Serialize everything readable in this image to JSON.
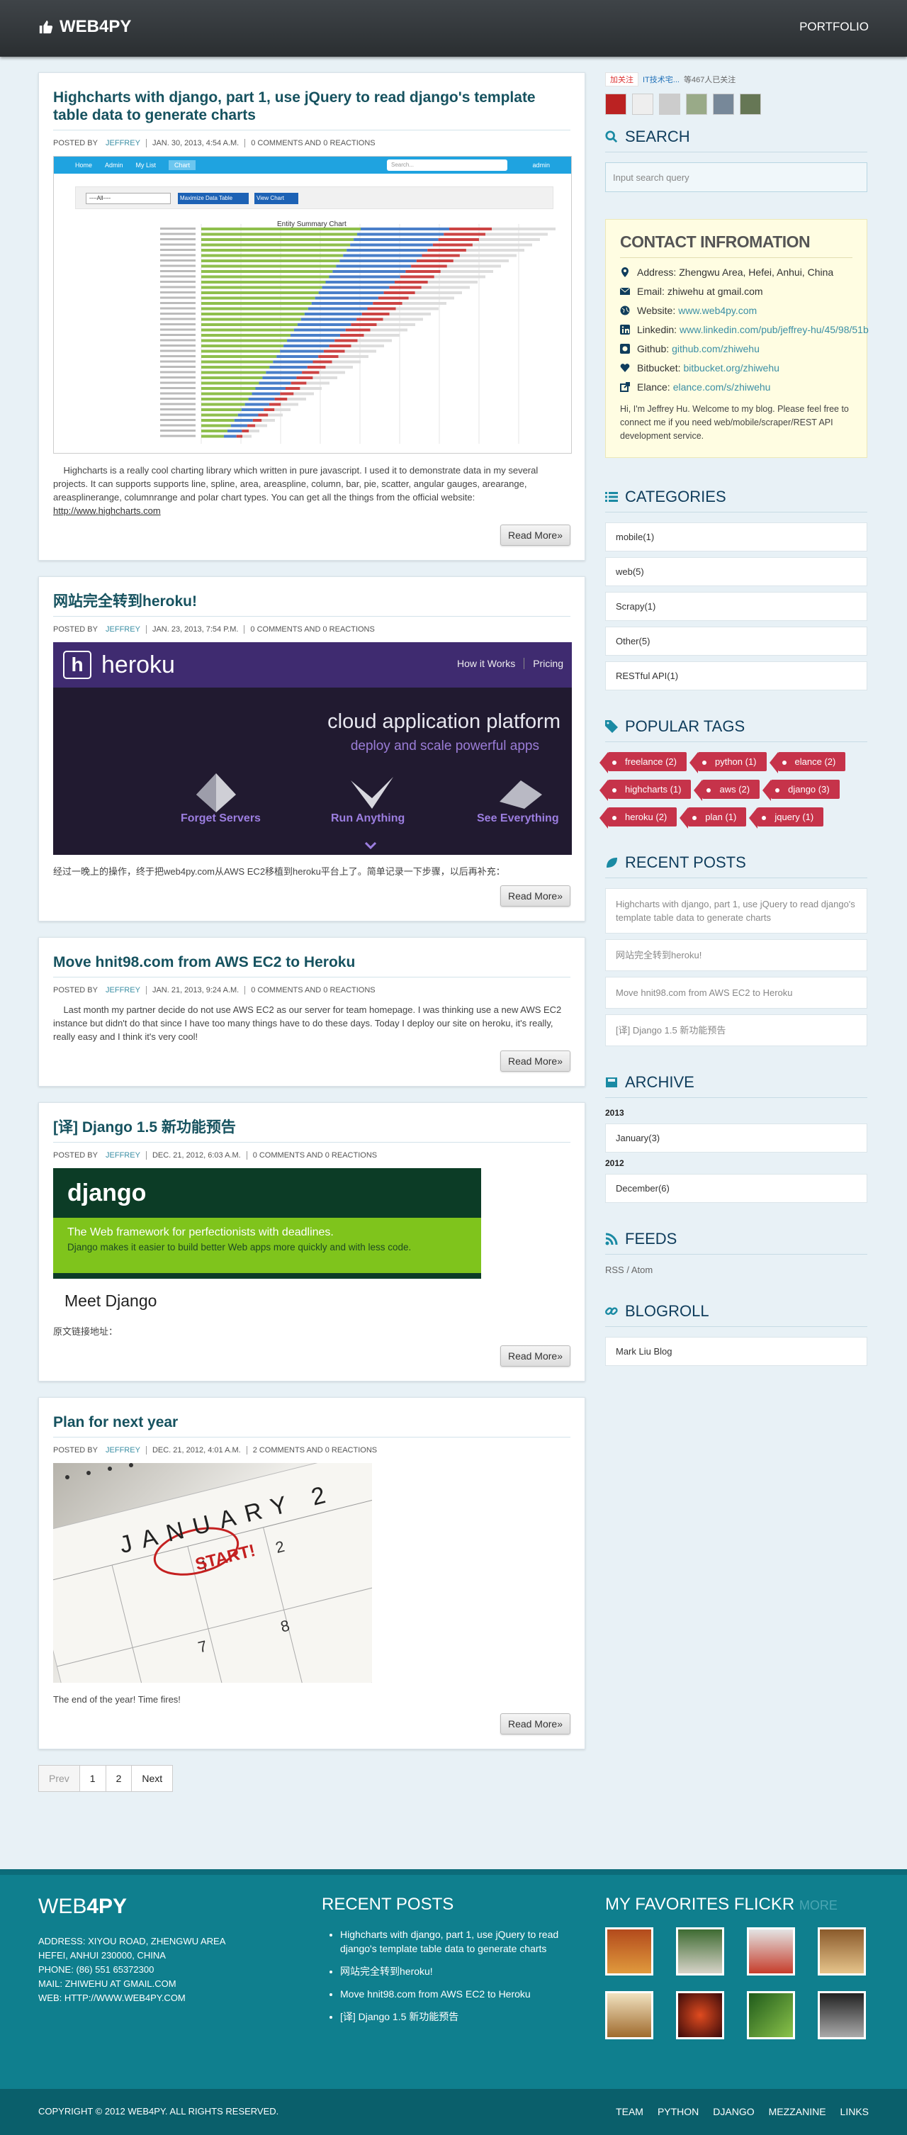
{
  "nav": {
    "brand": "WEB4PY",
    "portfolio": "PORTFOLIO"
  },
  "posts": [
    {
      "title": "Highcharts with django, part 1, use jQuery to read django's template table data to generate charts",
      "author": "JEFFREY",
      "date": "JAN. 30, 2013, 4:54 A.M.",
      "comments": "0 COMMENTS AND 0 REACTIONS",
      "body": "Highcharts is a really cool charting library which written in pure javascript. I used it to demonstrate data in my several projects. It can supports supports line, spline, area, areaspline, column, bar, pie, scatter, angular gauges, arearange, areasplinerange, columnrange and polar chart types.  You can get all the things from the official website: ",
      "link": "http://www.highcharts.com",
      "readmore": "Read More»"
    },
    {
      "title": "网站完全转到heroku!",
      "author": "JEFFREY",
      "date": "JAN. 23, 2013, 7:54 P.M.",
      "comments": "0 COMMENTS AND 0 REACTIONS",
      "body": "经过一晚上的操作，终于把web4py.com从AWS EC2移植到heroku平台上了。简单记录一下步骤，以后再补充：",
      "readmore": "Read More»"
    },
    {
      "title": "Move hnit98.com from AWS EC2 to Heroku",
      "author": "JEFFREY",
      "date": "JAN. 21, 2013, 9:24 A.M.",
      "comments": "0 COMMENTS AND 0 REACTIONS",
      "body": "Last month my partner decide do not use AWS EC2 as our server for team homepage. I was thinking use a new AWS EC2 instance  but didn't do that since I have too many things have to do these days. Today I deploy our site on heroku, it's really, really easy and I think it's very cool!",
      "readmore": "Read More»"
    },
    {
      "title": "[译] Django 1.5 新功能预告",
      "author": "JEFFREY",
      "date": "DEC. 21, 2012, 6:03 A.M.",
      "comments": "0 COMMENTS AND 0 REACTIONS",
      "body": "原文链接地址：",
      "readmore": "Read More»"
    },
    {
      "title": "Plan for next year",
      "author": "JEFFREY",
      "date": "DEC. 21, 2012, 4:01 A.M.",
      "comments": "2 COMMENTS AND 0 REACTIONS",
      "body": "The end of the year! Time fires!",
      "readmore": "Read More»"
    }
  ],
  "meta_posted_by": "POSTED BY",
  "shot1": {
    "nav": [
      "Home",
      "Admin",
      "My List",
      "Chart",
      "admin"
    ],
    "search": "Search...",
    "select": "----All----",
    "btn1": "Maximize Data Table",
    "btn2": "View Chart",
    "chart_title": "Entity Summary Chart"
  },
  "heroku": {
    "name": "heroku",
    "menu1": "How it Works",
    "menu2": "Pricing",
    "tag1": "cloud application platform",
    "tag2": "deploy and scale powerful apps",
    "f1": "Forget Servers",
    "f2": "Run Anything",
    "f3": "See Everything"
  },
  "django": {
    "logo": "django",
    "tag": "The Web framework for perfectionists with deadlines.",
    "sub": "Django makes it easier to build better Web apps more quickly and with less code.",
    "meet": "Meet Django"
  },
  "cal": {
    "month": "JANUARY 2",
    "start": "START!"
  },
  "pager": {
    "prev": "Prev",
    "p1": "1",
    "p2": "2",
    "next": "Next"
  },
  "side": {
    "weibo_follow": "加关注",
    "weibo_text": "IT技术宅...",
    "weibo_count": "等467人已关注",
    "search_title": "SEARCH",
    "search_placeholder": "Input search query",
    "contact_title": "CONTACT INFROMATION",
    "contact": [
      {
        "k": "Address:",
        "v": "Zhengwu Area, Hefei, Anhui, China",
        "icon": "map-marker-icon"
      },
      {
        "k": "Email:",
        "v": "zhiwehu at gmail.com",
        "icon": "envelope-icon"
      },
      {
        "k": "Website:",
        "v": "www.web4py.com",
        "icon": "globe-icon"
      },
      {
        "k": "Linkedin:",
        "v": "www.linkedin.com/pub/jeffrey-hu/45/98/51b",
        "icon": "linkedin-icon"
      },
      {
        "k": "Github:",
        "v": "github.com/zhiwehu",
        "icon": "github-icon"
      },
      {
        "k": "Bitbucket:",
        "v": "bitbucket.org/zhiwehu",
        "icon": "heart-icon"
      },
      {
        "k": "Elance:",
        "v": "elance.com/s/zhiwehu",
        "icon": "external-link-icon"
      }
    ],
    "contact_note": "Hi, I'm Jeffrey Hu. Welcome to my blog. Please feel free to connect me if you need web/mobile/scraper/REST API development service.",
    "cat_title": "CATEGORIES",
    "categories": [
      "mobile(1)",
      "web(5)",
      "Scrapy(1)",
      "Other(5)",
      "RESTful API(1)"
    ],
    "tags_title": "POPULAR TAGS",
    "tags": [
      "freelance (2)",
      "python (1)",
      "elance (2)",
      "highcharts (1)",
      "aws (2)",
      "django (3)",
      "heroku (2)",
      "plan (1)",
      "jquery (1)"
    ],
    "recent_title": "RECENT POSTS",
    "recent": [
      "Highcharts with django, part 1, use jQuery to read django's template table data to generate charts",
      "网站完全转到heroku!",
      "Move hnit98.com from AWS EC2 to Heroku",
      "[译] Django 1.5 新功能预告"
    ],
    "archive_title": "ARCHIVE",
    "year1": "2013",
    "month1": "January(3)",
    "year2": "2012",
    "month2": "December(6)",
    "feeds_title": "FEEDS",
    "rss": "RSS",
    "atom": "Atom",
    "feeds_sep": " / ",
    "blogroll_title": "BLOGROLL",
    "blogroll": [
      "Mark Liu Blog"
    ]
  },
  "footer": {
    "brand_a": "WEB",
    "brand_b": "4PY",
    "addr": [
      "ADDRESS: XIYOU ROAD, ZHENGWU AREA",
      "HEFEI, ANHUI 230000, CHINA",
      "PHONE: (86) 551 65372300",
      "MAIL: ZHIWEHU AT GMAIL.COM",
      "WEB: HTTP://WWW.WEB4PY.COM"
    ],
    "recent_title": "RECENT POSTS",
    "recent": [
      "Highcharts with django, part 1, use jQuery to read django's template table data to generate charts",
      "网站完全转到heroku!",
      "Move hnit98.com from AWS EC2 to Heroku",
      "[译] Django 1.5 新功能预告"
    ],
    "flickr_title": "MY FAVORITES FLICKR",
    "flickr_more": "MORE",
    "copyright": "COPYRIGHT © 2012 WEB4PY. ALL RIGHTS RESERVED.",
    "links": [
      "TEAM",
      "PYTHON",
      "DJANGO",
      "MEZZANINE",
      "LINKS"
    ]
  },
  "colors": {
    "accent": "#16525f",
    "tag": "#c6334a",
    "footer": "#0f7f8e"
  }
}
